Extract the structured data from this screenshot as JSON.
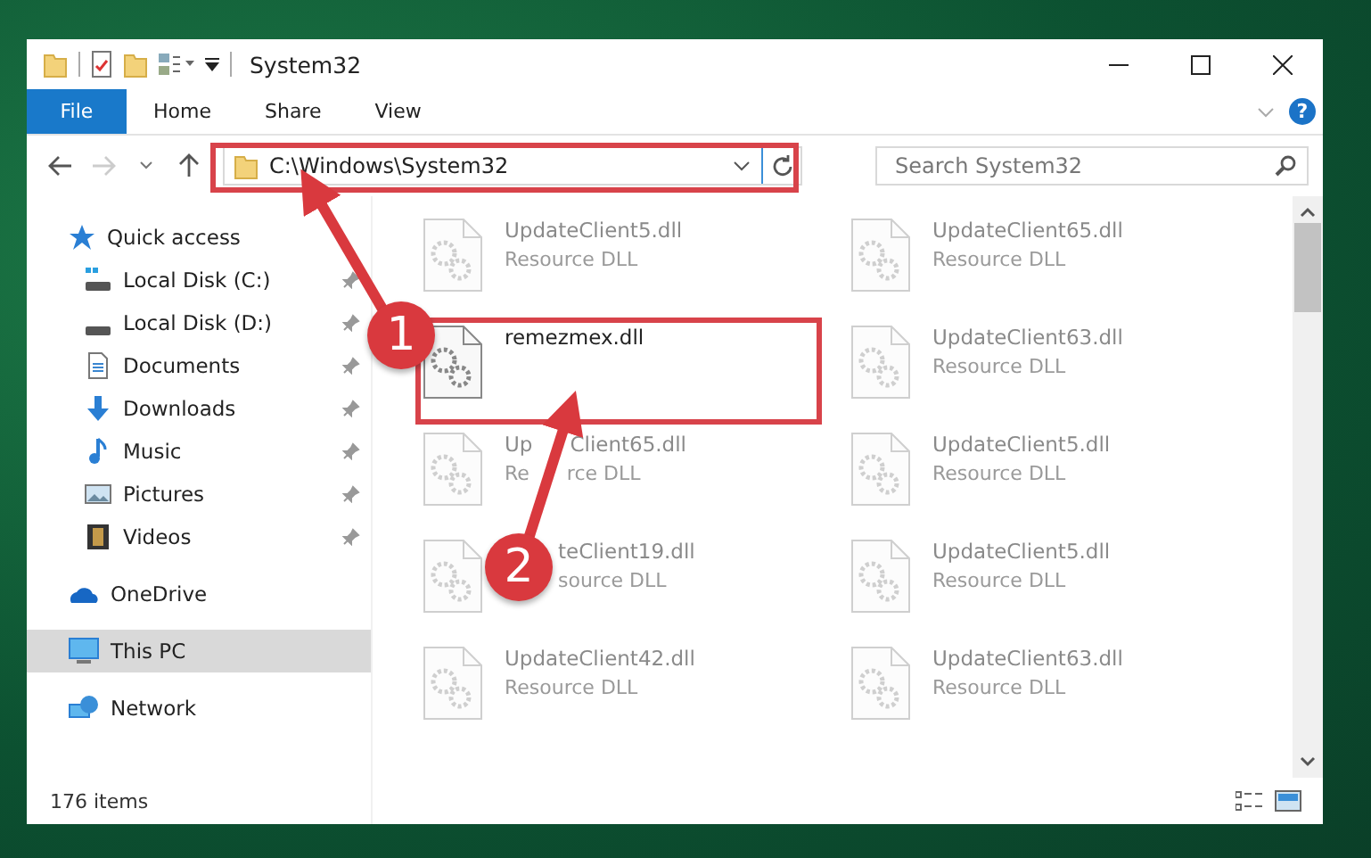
{
  "window": {
    "title": "System32"
  },
  "ribbon": {
    "tabs": [
      {
        "label": "File",
        "selected": true
      },
      {
        "label": "Home",
        "selected": false
      },
      {
        "label": "Share",
        "selected": false
      },
      {
        "label": "View",
        "selected": false
      }
    ],
    "help": "?"
  },
  "address_bar": {
    "path": "C:\\Windows\\System32"
  },
  "search": {
    "placeholder": "Search System32"
  },
  "sidebar": {
    "items": [
      {
        "label": "Quick access",
        "selected": false,
        "children": [
          {
            "label": "Local Disk (C:)",
            "pinned": true,
            "selected": false
          },
          {
            "label": "Local Disk (D:)",
            "pinned": true,
            "selected": false
          },
          {
            "label": "Documents",
            "pinned": true,
            "selected": false
          },
          {
            "label": "Downloads",
            "pinned": true,
            "selected": false
          },
          {
            "label": "Music",
            "pinned": true,
            "selected": false
          },
          {
            "label": "Pictures",
            "pinned": true,
            "selected": false
          },
          {
            "label": "Videos",
            "pinned": true,
            "selected": false
          }
        ]
      },
      {
        "label": "OneDrive",
        "selected": false
      },
      {
        "label": "This PC",
        "selected": true
      },
      {
        "label": "Network",
        "selected": false
      }
    ]
  },
  "files": [
    {
      "kind": "plain",
      "name": [
        "UpdateClient5.dll"
      ],
      "type": [
        "Resource DLL"
      ],
      "dimmed": true
    },
    {
      "kind": "plain",
      "name": [
        "UpdateClient65.dll"
      ],
      "type": [
        "Resource DLL"
      ],
      "dimmed": true
    },
    {
      "kind": "plain",
      "name": [
        "remezmex.dll"
      ],
      "dimmed": false
    },
    {
      "kind": "plain",
      "name": [
        "UpdateClient63.dll"
      ],
      "type": [
        "Resource DLL"
      ],
      "dimmed": true
    },
    {
      "kind": "split",
      "name": [
        "Up",
        "Client65.dll"
      ],
      "type": [
        "Re",
        "rce DLL"
      ],
      "dimmed": true
    },
    {
      "kind": "plain",
      "name": [
        "UpdateClient5.dll"
      ],
      "type": [
        "Resource DLL"
      ],
      "dimmed": true
    },
    {
      "kind": "offset",
      "name": [
        "teClient19.dll"
      ],
      "type": [
        "source DLL"
      ],
      "dimmed": true
    },
    {
      "kind": "plain",
      "name": [
        "UpdateClient5.dll"
      ],
      "type": [
        "Resource DLL"
      ],
      "dimmed": true
    },
    {
      "kind": "plain",
      "name": [
        "UpdateClient42.dll"
      ],
      "type": [
        "Resource DLL"
      ],
      "dimmed": true
    },
    {
      "kind": "plain",
      "name": [
        "UpdateClient63.dll"
      ],
      "type": [
        "Resource DLL"
      ],
      "dimmed": true
    }
  ],
  "status_bar": {
    "count": "176 items"
  },
  "annotations": [
    {
      "number": "1"
    },
    {
      "number": "2"
    }
  ]
}
